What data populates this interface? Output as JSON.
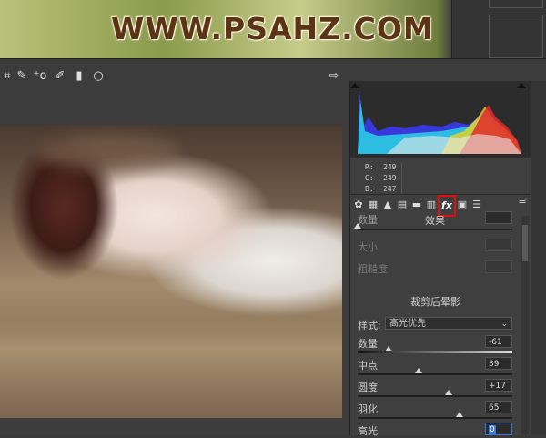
{
  "watermark": "WWW.PSAHZ.COM",
  "toolbar": {
    "tools": [
      "crop-icon",
      "spot-removal-icon",
      "redeye-icon",
      "adjustment-brush-icon",
      "graduated-filter-icon",
      "radial-filter-icon"
    ],
    "export_icon": "export-icon"
  },
  "histogram": {
    "readout": {
      "r_label": "R:",
      "r": "249",
      "g_label": "G:",
      "g": "249",
      "b_label": "B:",
      "b": "247"
    }
  },
  "tabs": {
    "icons": [
      "basic-icon",
      "tone-curve-icon",
      "detail-icon",
      "hsl-icon",
      "split-toning-icon",
      "lens-icon",
      "fx-icon",
      "camera-calibration-icon",
      "presets-icon"
    ],
    "active": "fx-icon",
    "fx_label": "fx"
  },
  "effects": {
    "section_title": "效果",
    "partial_label": "数量",
    "size_label": "大小",
    "roughness_label": "粗糙度"
  },
  "vignette": {
    "title": "裁剪后晕影",
    "style_label": "样式:",
    "style_value": "高光优先",
    "amount_label": "数量",
    "amount_value": "-61",
    "midpoint_label": "中点",
    "midpoint_value": "39",
    "roundness_label": "圆度",
    "roundness_value": "+17",
    "feather_label": "羽化",
    "feather_value": "65",
    "highlights_label": "高光",
    "highlights_value": "0"
  },
  "colors": {
    "accent_red": "#e01010",
    "panel_bg": "#3f3f3f",
    "active_field": "#3b78d8"
  }
}
